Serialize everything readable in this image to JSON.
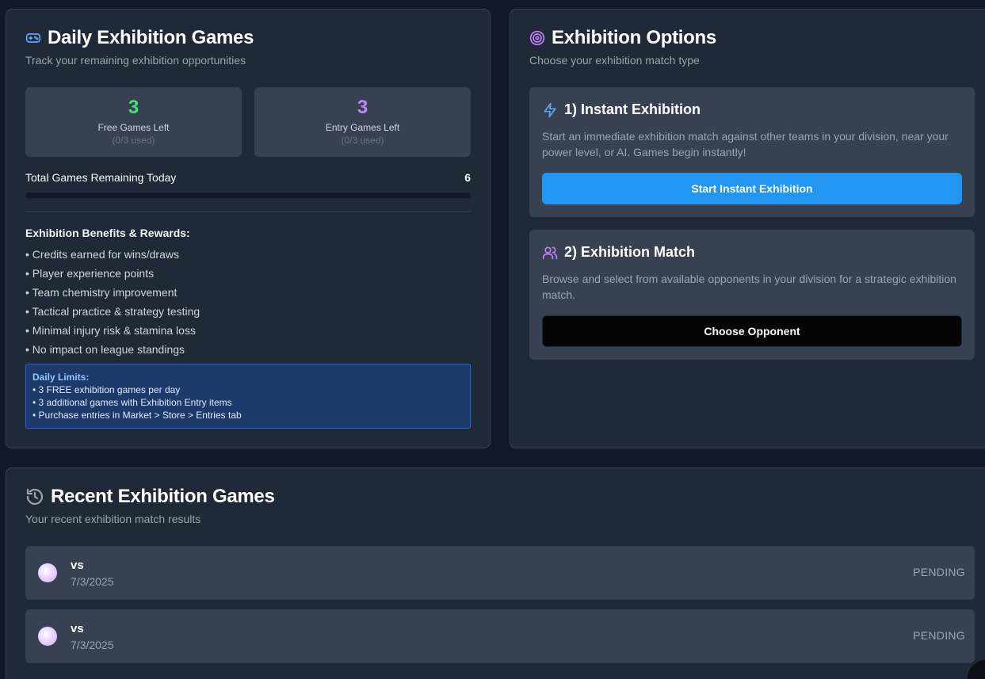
{
  "daily": {
    "title": "Daily Exhibition Games",
    "subtitle": "Track your remaining exhibition opportunities",
    "icon": "gamepad-icon",
    "free": {
      "count": "3",
      "label": "Free Games Left",
      "used": "(0/3 used)",
      "color": "#4ade80"
    },
    "entry": {
      "count": "3",
      "label": "Entry Games Left",
      "used": "(0/3 used)",
      "color": "#c084fc"
    },
    "total_label": "Total Games Remaining Today",
    "total_value": "6",
    "used_fraction": 0,
    "benefits_title": "Exhibition Benefits & Rewards:",
    "benefits": [
      "• Credits earned for wins/draws",
      "• Player experience points",
      "• Team chemistry improvement",
      "• Tactical practice & strategy testing",
      "• Minimal injury risk & stamina loss",
      "• No impact on league standings"
    ],
    "limits_title": "Daily Limits:",
    "limits": [
      "• 3 FREE exhibition games per day",
      "• 3 additional games with Exhibition Entry items",
      "• Purchase entries in Market > Store > Entries tab"
    ]
  },
  "options": {
    "title": "Exhibition Options",
    "subtitle": "Choose your exhibition match type",
    "icon": "target-icon",
    "instant": {
      "icon": "lightning-icon",
      "title": "1) Instant Exhibition",
      "description": "Start an immediate exhibition match against other teams in your division, near your power level, or AI. Games begin instantly!",
      "button": "Start Instant Exhibition"
    },
    "match": {
      "icon": "users-icon",
      "title": "2) Exhibition Match",
      "description": "Browse and select from available opponents in your division for a strategic exhibition match.",
      "button": "Choose Opponent"
    }
  },
  "recent": {
    "title": "Recent Exhibition Games",
    "subtitle": "Your recent exhibition match results",
    "icon": "history-icon",
    "games": [
      {
        "vs": "vs",
        "date": "7/3/2025",
        "status": "PENDING"
      },
      {
        "vs": "vs",
        "date": "7/3/2025",
        "status": "PENDING"
      }
    ]
  },
  "colors": {
    "accent_blue": "#2196f3",
    "free_green": "#4ade80",
    "entry_purple": "#c084fc"
  }
}
